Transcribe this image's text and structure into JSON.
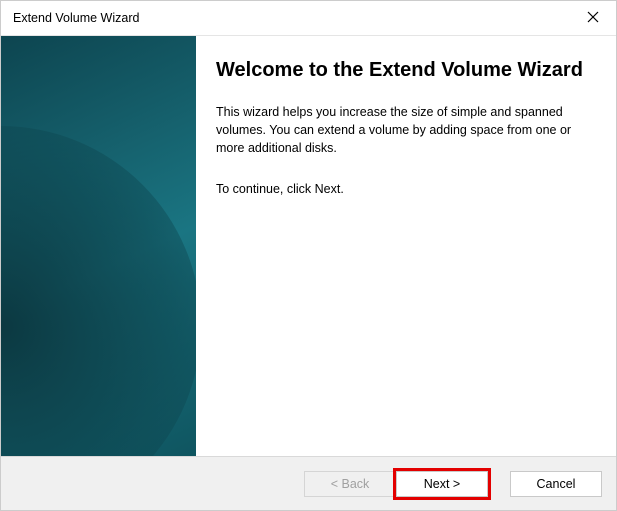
{
  "titlebar": {
    "title": "Extend Volume Wizard"
  },
  "content": {
    "heading": "Welcome to the Extend Volume Wizard",
    "body": "This wizard helps you increase the size of simple and spanned volumes. You can extend a volume  by adding space from one or more additional disks.",
    "continue": "To continue, click Next."
  },
  "buttons": {
    "back": "< Back",
    "next": "Next >",
    "cancel": "Cancel"
  }
}
